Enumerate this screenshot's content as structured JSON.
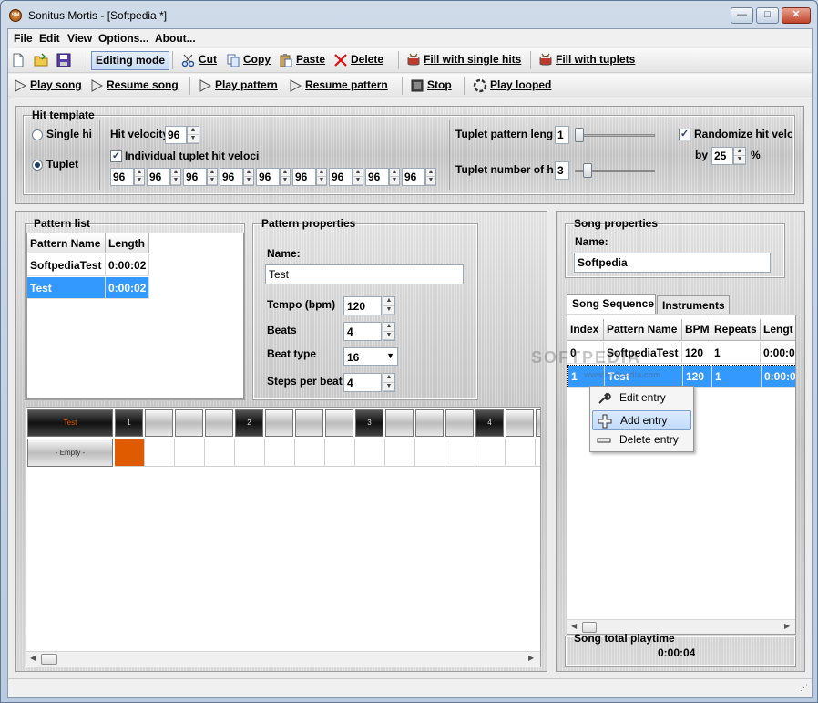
{
  "window": {
    "title": "Sonitus Mortis - [Softpedia *]",
    "app_icon_text": "SM",
    "controls": {
      "minimize": "—",
      "maximize": "□",
      "close": "✕"
    }
  },
  "menu": [
    "File",
    "Edit",
    "View",
    "Options...",
    "About..."
  ],
  "toolbar1": {
    "editing_mode": "Editing mode",
    "cut": "Cut",
    "copy": "Copy",
    "paste": "Paste",
    "delete": "Delete",
    "fill_single": "Fill with single hits",
    "fill_tuplets": "Fill with tuplets"
  },
  "toolbar2": {
    "play_song": "Play song",
    "resume_song": "Resume song",
    "play_pattern": "Play pattern",
    "resume_pattern": "Resume pattern",
    "stop": "Stop",
    "play_looped": "Play looped"
  },
  "hit_template": {
    "title": "Hit template",
    "single_hit": "Single hi",
    "tuplet": "Tuplet",
    "hit_velocity_label": "Hit velocity",
    "hit_velocity_value": "96",
    "individual_label": "Individual tuplet hit veloci",
    "tuplet_velocities": [
      "96",
      "96",
      "96",
      "96",
      "96",
      "96",
      "96",
      "96",
      "96"
    ],
    "tuplet_pattern_label": "Tuplet pattern leng",
    "tuplet_pattern_value": "1",
    "tuplet_pattern_level": 0.0,
    "tuplet_number_label": "Tuplet number of h",
    "tuplet_number_value": "3",
    "tuplet_number_level": 0.12,
    "randomize_label": "Randomize hit veloc",
    "by_label": "by",
    "by_value": "25",
    "percent": "%"
  },
  "pattern_list": {
    "title": "Pattern list",
    "columns": [
      "Pattern Name",
      "Length"
    ],
    "rows": [
      {
        "name": "SoftpediaTest",
        "length": "0:00:02"
      },
      {
        "name": "Test",
        "length": "0:00:02"
      }
    ]
  },
  "pattern_properties": {
    "title": "Pattern properties",
    "name_label": "Name:",
    "name_value": "Test",
    "tempo_label": "Tempo (bpm)",
    "tempo_value": "120",
    "beats_label": "Beats",
    "beats_value": "4",
    "beat_type_label": "Beat type",
    "beat_type_value": "16",
    "steps_label": "Steps per beat",
    "steps_value": "4"
  },
  "sequencer": {
    "pattern_tag": "Test",
    "empty_tag": "- Empty -",
    "beat_numbers": [
      "1",
      "2",
      "3",
      "4"
    ]
  },
  "song_properties": {
    "title": "Song properties",
    "name_label": "Name:",
    "name_value": "Softpedia"
  },
  "song_tabs": [
    "Song Sequence",
    "Instruments"
  ],
  "song_sequence": {
    "columns": [
      "Index",
      "Pattern Name",
      "BPM",
      "Repeats",
      "Lengt"
    ],
    "rows": [
      {
        "index": "0",
        "pattern": "SoftpediaTest",
        "bpm": "120",
        "repeats": "1",
        "length": "0:00:0"
      },
      {
        "index": "1",
        "pattern": "Test",
        "bpm": "120",
        "repeats": "1",
        "length": "0:00:0"
      }
    ]
  },
  "context_menu": [
    "Edit entry",
    "Add entry",
    "Delete entry"
  ],
  "song_total": {
    "label": "Song total playtime",
    "value": "0:00:04"
  },
  "watermark": "SOFTPEDIA",
  "watermark_url": "www.softpedia.com"
}
